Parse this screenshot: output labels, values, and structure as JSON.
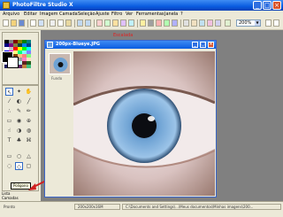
{
  "window": {
    "title": "PhotoFiltre Studio X",
    "min": "_",
    "max": "□",
    "close": "×"
  },
  "menu": [
    "Arquivo",
    "Editar",
    "Imagem",
    "Camada",
    "Seleção",
    "Ajuste",
    "Filtro",
    "Ver",
    "Ferramentas",
    "Janela",
    "?"
  ],
  "toolbar": {
    "zoom": "200%",
    "zoom_arrow": "▼"
  },
  "document": {
    "title": "200px-Blueye.JPG",
    "layer_label": "Fundo",
    "min": "_",
    "max": "□",
    "close": "×"
  },
  "overlay_label": "Escalada",
  "tooltip": "Polígono",
  "layers_panel": {
    "item1": "Lista",
    "item2": "Camadas"
  },
  "status": {
    "left": "Pronto",
    "size": "200x200x16M",
    "path": "C:\\Documents and Settings\\...\\Meus documentos\\Minhas imagens\\200..."
  },
  "colors": {
    "accent": "#0a5ce0",
    "iris": "#6fa3d4",
    "arrow": "#d02020"
  },
  "palette": [
    "#000000",
    "#808080",
    "#800000",
    "#808000",
    "#008000",
    "#008080",
    "#000080",
    "#800080",
    "#808040",
    "#004040",
    "#0080ff",
    "#004080",
    "#ffffff",
    "#c0c0c0",
    "#ff0000",
    "#ffff00",
    "#00ff00",
    "#00ffff",
    "#0000ff",
    "#ff00ff",
    "#ffff80",
    "#00ff80",
    "#80ffff",
    "#8080ff",
    "#ff0080",
    "#ff8040",
    "#804000",
    "#ffc080",
    "#ff8080",
    "#80ff80",
    "#c0c0ff",
    "#ffc0ff",
    "#404040",
    "#a0a0a0",
    "#ff80c0",
    "#ffe0c0",
    "#e0e0ff",
    "#c0ffc0",
    "#ffffc0",
    "#c0ffff",
    "#602020",
    "#206020",
    "#202060",
    "#606020",
    "#206060",
    "#602060",
    "#c08040",
    "#40c080"
  ]
}
